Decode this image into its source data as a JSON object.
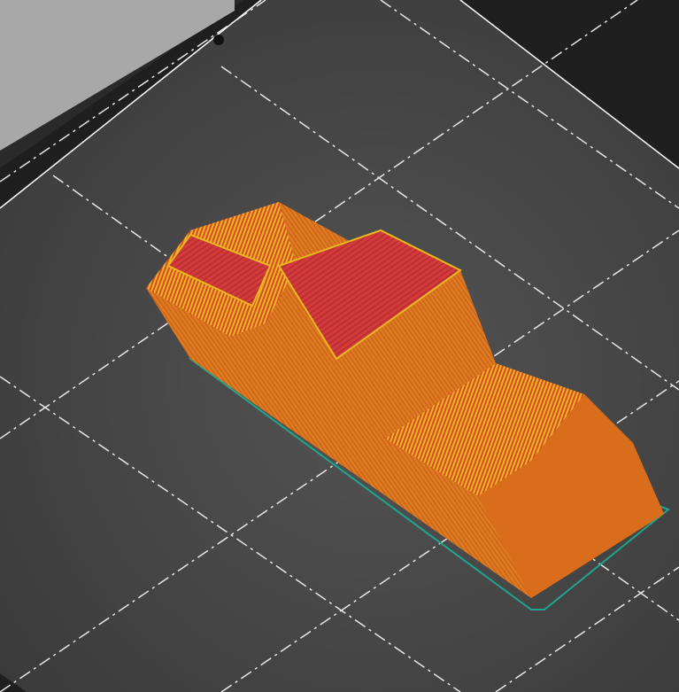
{
  "view": {
    "mode": "slice-preview-3d"
  },
  "colors": {
    "background": "#2a2a2a",
    "bed_border": "#1f1f1f",
    "bed_surface": "#474747",
    "bed_edge": "#ffffff",
    "grid": "#e8e8e8",
    "perimeter": "#e07a20",
    "top_solid_infill": "#d33a3a",
    "solid_infill": "#e0b020",
    "skirt": "#1fa58a"
  }
}
